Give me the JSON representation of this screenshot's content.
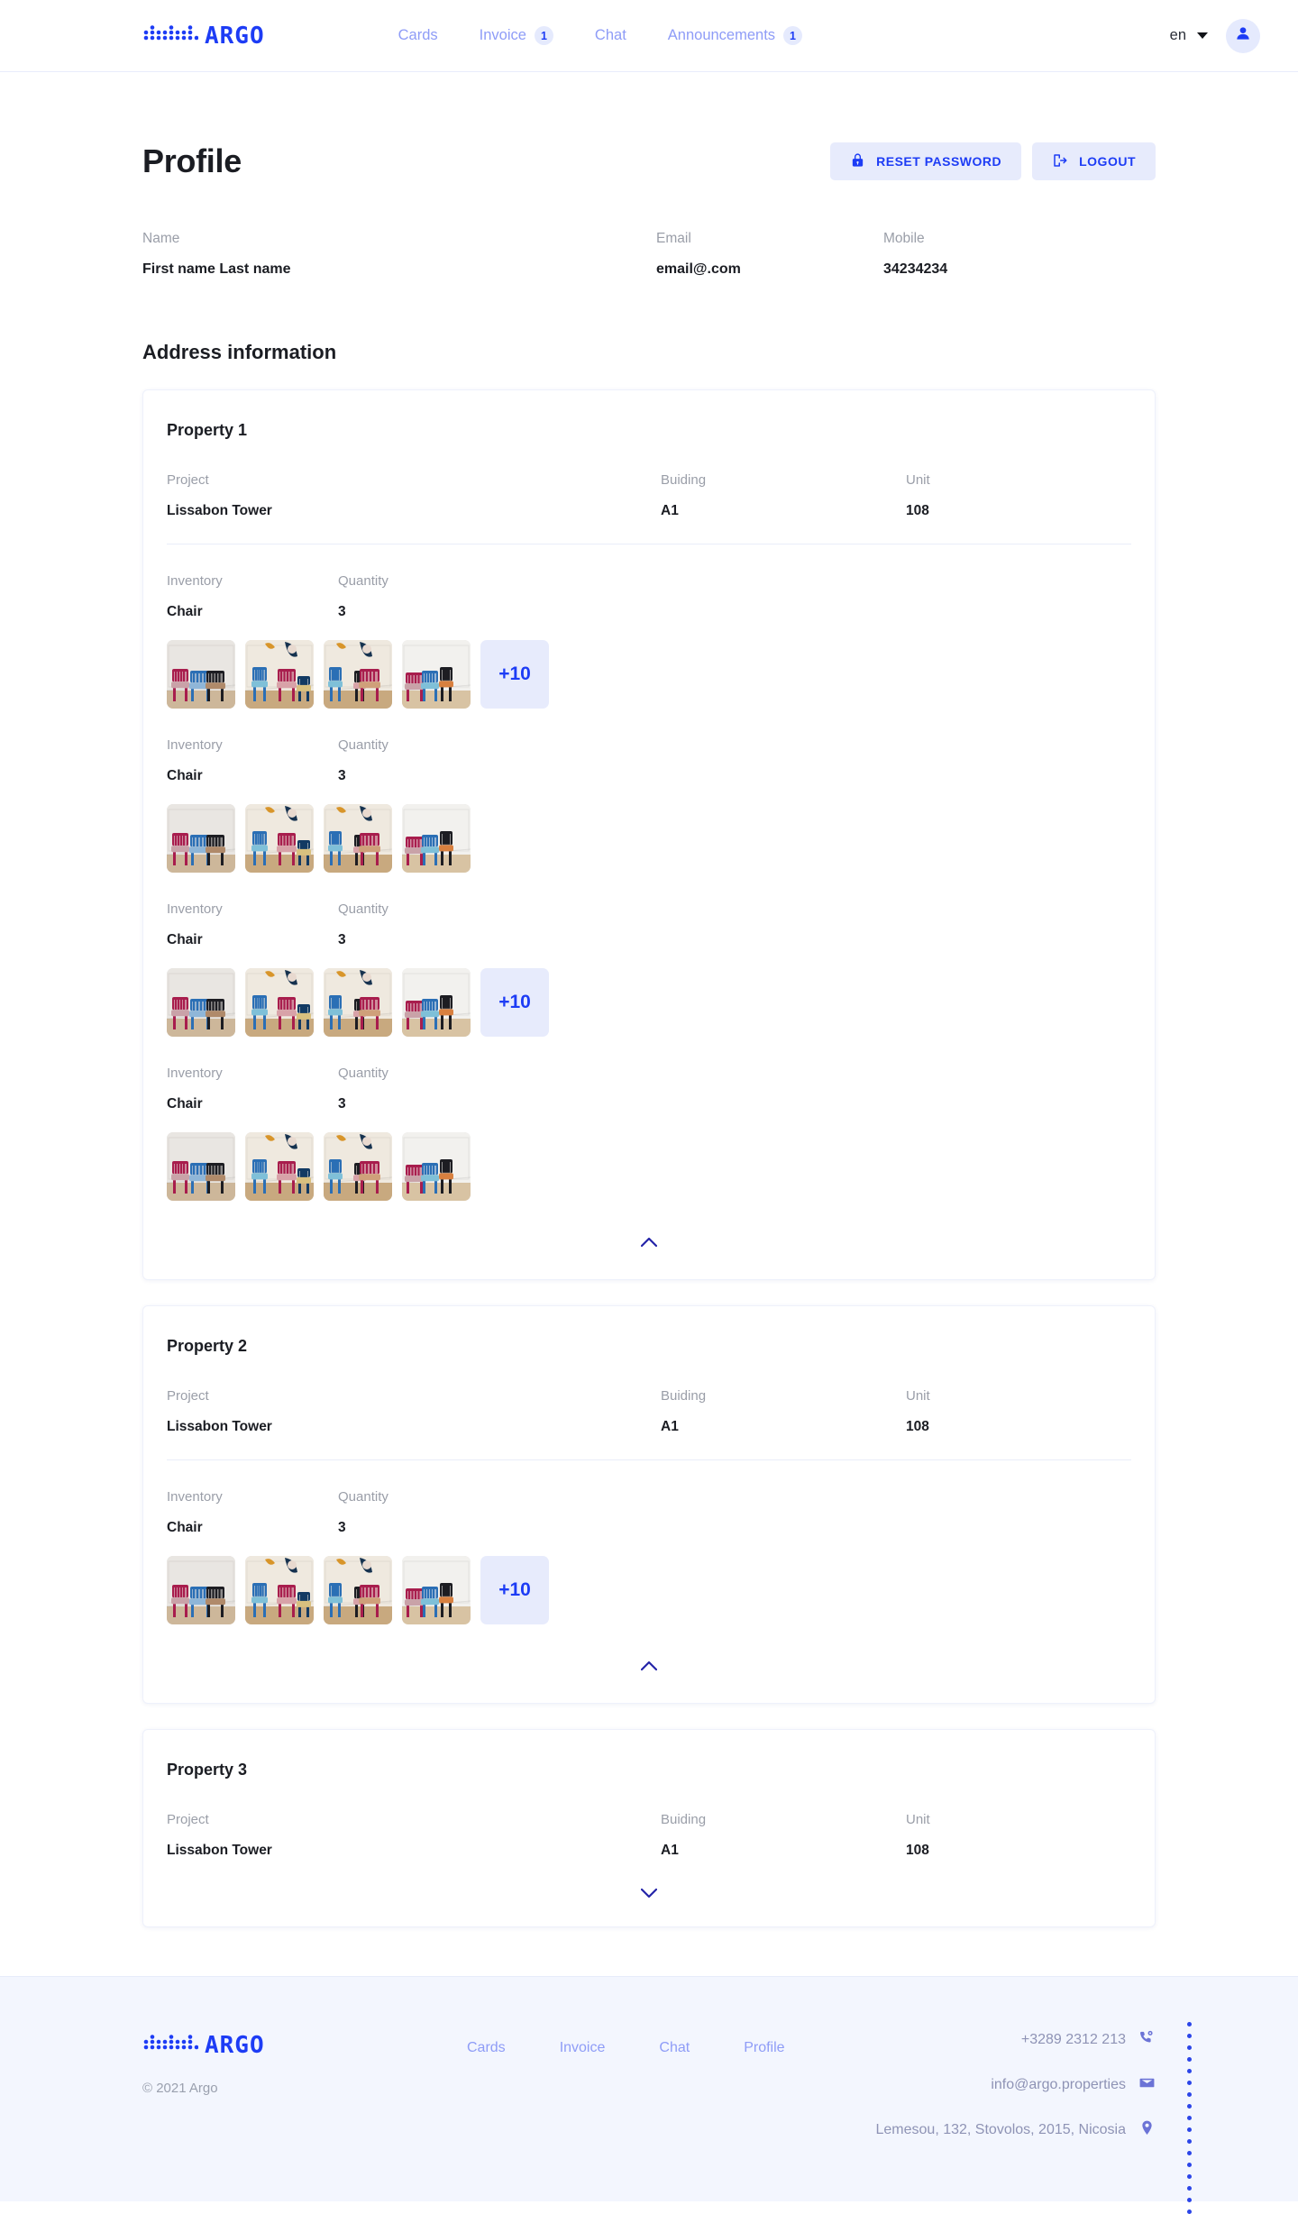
{
  "brand": {
    "name": "ARGO",
    "logo_icon": "argo-dots-logo"
  },
  "header": {
    "nav": [
      {
        "label": "Cards",
        "badge": null
      },
      {
        "label": "Invoice",
        "badge": "1"
      },
      {
        "label": "Chat",
        "badge": null
      },
      {
        "label": "Announcements",
        "badge": "1"
      }
    ],
    "language": {
      "value": "en",
      "caret_icon": "chevron-down-icon"
    },
    "avatar_icon": "user-avatar-icon"
  },
  "main": {
    "page_title": "Profile",
    "actions": [
      {
        "label": "RESET PASSWORD",
        "icon": "lock-icon",
        "name": "reset-password-button"
      },
      {
        "label": "LOGOUT",
        "icon": "logout-icon",
        "name": "logout-button"
      }
    ],
    "profile_fields": [
      {
        "label": "Name",
        "value": "First name Last name"
      },
      {
        "label": "Email",
        "value": "email@.com"
      },
      {
        "label": "Mobile",
        "value": "34234234"
      }
    ],
    "section_title": "Address information",
    "labels": {
      "project": "Project",
      "building": "Buiding",
      "unit": "Unit",
      "inventory": "Inventory",
      "quantity": "Quantity"
    },
    "properties": [
      {
        "title": "Property 1",
        "project": "Lissabon Tower",
        "building": "A1",
        "unit": "108",
        "expanded": true,
        "chevron_icon": "chevron-up-icon",
        "inventories": [
          {
            "name": "Chair",
            "quantity": "3",
            "thumbs": 4,
            "more": "+10"
          },
          {
            "name": "Chair",
            "quantity": "3",
            "thumbs": 4,
            "more": null
          },
          {
            "name": "Chair",
            "quantity": "3",
            "thumbs": 4,
            "more": "+10"
          },
          {
            "name": "Chair",
            "quantity": "3",
            "thumbs": 4,
            "more": null
          }
        ]
      },
      {
        "title": "Property 2",
        "project": "Lissabon Tower",
        "building": "A1",
        "unit": "108",
        "expanded": true,
        "chevron_icon": "chevron-up-icon",
        "inventories": [
          {
            "name": "Chair",
            "quantity": "3",
            "thumbs": 4,
            "more": "+10"
          }
        ]
      },
      {
        "title": "Property 3",
        "project": "Lissabon Tower",
        "building": "A1",
        "unit": "108",
        "expanded": false,
        "chevron_icon": "chevron-down-icon",
        "inventories": []
      }
    ]
  },
  "footer": {
    "copyright": "© 2021 Argo",
    "links": [
      "Cards",
      "Invoice",
      "Chat",
      "Profile"
    ],
    "contacts": [
      {
        "text": "+3289 2312 213",
        "icon": "phone-icon"
      },
      {
        "text": "info@argo.properties",
        "icon": "mail-icon"
      },
      {
        "text": "Lemesou, 132, Stovolos, 2015, Nicosia",
        "icon": "location-pin-icon"
      }
    ]
  },
  "colors": {
    "accent": "#1d3cf5",
    "accent_soft": "#e7ebfc",
    "nav_text": "#8e9cf7",
    "footer_bg": "#f3f6fe"
  }
}
